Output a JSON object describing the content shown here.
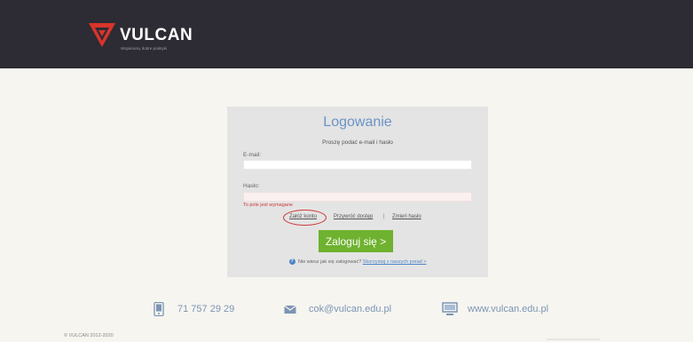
{
  "header": {
    "brand_name": "VULCAN",
    "brand_tagline": "Wspieramy dobre praktyki"
  },
  "login": {
    "title": "Logowanie",
    "subtitle": "Proszę podać e-mail i hasło",
    "email_label": "E-mail:",
    "email_value": "",
    "password_label": "Hasło:",
    "password_value": "",
    "error_text": "To pole jest wymagane",
    "links": {
      "create_account": "Załóż konto",
      "restore_access": "Przywróć dostęp",
      "separator": "|",
      "change_password": "Zmień hasło"
    },
    "login_button": "Zaloguj się >",
    "help_text": "Nie wiesz jak się zalogować?",
    "help_link": "Skorzystaj z naszych porad >"
  },
  "contact": {
    "phone": "71 757 29 29",
    "email": "cok@vulcan.edu.pl",
    "website": "www.vulcan.edu.pl"
  },
  "footer": {
    "copyright": "© VULCAN 2012-2020"
  },
  "colors": {
    "header_bg": "#2d2b33",
    "logo_red": "#d8342b",
    "title_blue": "#6b93c6",
    "login_green": "#6fb22f",
    "error_red": "#cc3a3a"
  }
}
